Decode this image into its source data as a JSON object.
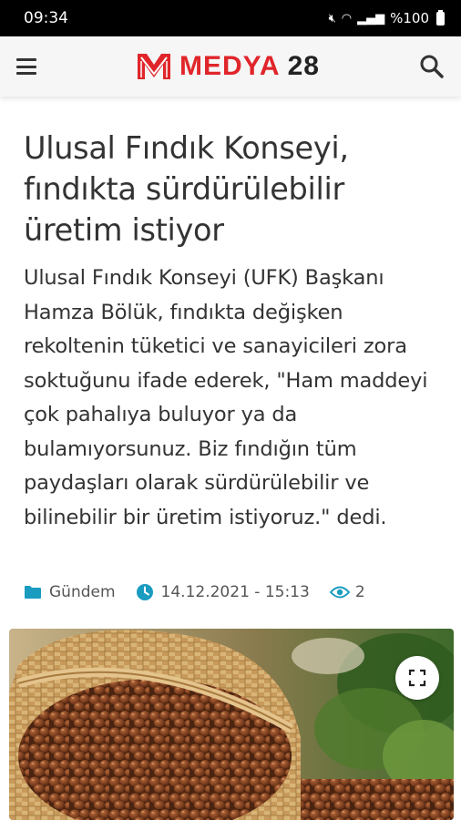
{
  "status_bar": {
    "time": "09:34",
    "battery": "%100"
  },
  "header": {
    "logo_brand": "MEDYA",
    "logo_number": "28"
  },
  "article": {
    "title": "Ulusal Fındık Konseyi, fındıkta sürdürülebilir üretim istiyor",
    "summary": "Ulusal Fındık Konseyi (UFK) Başkanı Hamza Bölük, fındıkta değişken rekoltenin tüketici ve sanayicileri zora soktuğunu ifade ederek, \"Ham maddeyi çok pahalıya buluyor ya da bulamıyorsunuz. Biz fındığın tüm paydaşları olarak sürdürülebilir ve bilinebilir bir üretim istiyoruz.\" dedi.",
    "category": "Gündem",
    "datetime": "14.12.2021 - 15:13",
    "views": "2"
  },
  "icons": {
    "menu": "hamburger-menu-icon",
    "search": "search-icon",
    "category": "folder-icon",
    "datetime": "clock-icon",
    "views": "eye-icon",
    "expand": "fullscreen-expand-icon"
  },
  "colors": {
    "brand_red": "#e0262b",
    "accent_teal": "#1a9cc0",
    "text": "#333333"
  }
}
